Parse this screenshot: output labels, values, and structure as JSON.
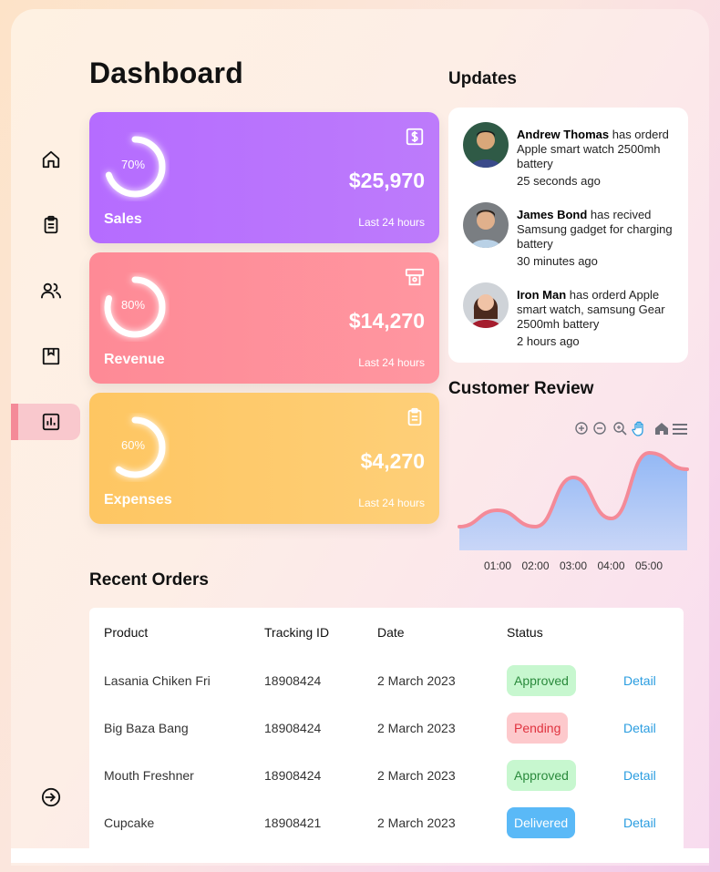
{
  "page": {
    "title": "Dashboard"
  },
  "sidebar": {
    "items": [
      {
        "icon": "home-icon"
      },
      {
        "icon": "clipboard-icon"
      },
      {
        "icon": "users-icon"
      },
      {
        "icon": "bookmark-box-icon"
      },
      {
        "icon": "bar-chart-icon",
        "active": true
      }
    ],
    "logout_icon": "logout-icon"
  },
  "cards": [
    {
      "label": "Sales",
      "amount": "$25,970",
      "percent_text": "70%",
      "percent": 70,
      "period": "Last 24 hours",
      "icon": "dollar-icon",
      "color": "#b56cff"
    },
    {
      "label": "Revenue",
      "amount": "$14,270",
      "percent_text": "80%",
      "percent": 80,
      "period": "Last 24 hours",
      "icon": "atm-icon",
      "color": "#fe8a96"
    },
    {
      "label": "Expenses",
      "amount": "$4,270",
      "percent_text": "60%",
      "percent": 60,
      "period": "Last 24 hours",
      "icon": "clipboard-icon",
      "color": "#fec662"
    }
  ],
  "updates": {
    "title": "Updates",
    "items": [
      {
        "name": "Andrew Thomas",
        "text": " has orderd Apple smart watch 2500mh battery",
        "time": "25 seconds ago"
      },
      {
        "name": "James Bond",
        "text": " has recived Samsung gadget for charging battery",
        "time": "30 minutes ago"
      },
      {
        "name": "Iron Man",
        "text": " has orderd Apple smart watch, samsung Gear 2500mh battery",
        "time": "2 hours ago"
      }
    ]
  },
  "review": {
    "title": "Customer Review",
    "toolbar": [
      "zoom-in-icon",
      "zoom-out-icon",
      "magnifier-icon",
      "pan-hand-icon",
      "home-icon",
      "menu-icon"
    ]
  },
  "chart_data": {
    "type": "area",
    "x": [
      "01:00",
      "02:00",
      "03:00",
      "04:00",
      "05:00"
    ],
    "series": [
      {
        "values": [
          2,
          4,
          2,
          8,
          3,
          11,
          9
        ]
      }
    ],
    "ylim": [
      0,
      12
    ],
    "grid": false,
    "color": "#f48a98",
    "fill": "#a9c6f7"
  },
  "orders": {
    "title": "Recent Orders",
    "headers": [
      "Product",
      "Tracking ID",
      "Date",
      "Status"
    ],
    "rows": [
      {
        "product": "Lasania Chiken Fri",
        "tracking": "18908424",
        "date": "2 March 2023",
        "status": "Approved",
        "action": "Detail"
      },
      {
        "product": "Big Baza Bang",
        "tracking": "18908424",
        "date": "2 March 2023",
        "status": "Pending",
        "action": "Detail"
      },
      {
        "product": "Mouth Freshner",
        "tracking": "18908424",
        "date": "2 March 2023",
        "status": "Approved",
        "action": "Detail"
      },
      {
        "product": "Cupcake",
        "tracking": "18908421",
        "date": "2 March 2023",
        "status": "Delivered",
        "action": "Detail"
      }
    ]
  }
}
